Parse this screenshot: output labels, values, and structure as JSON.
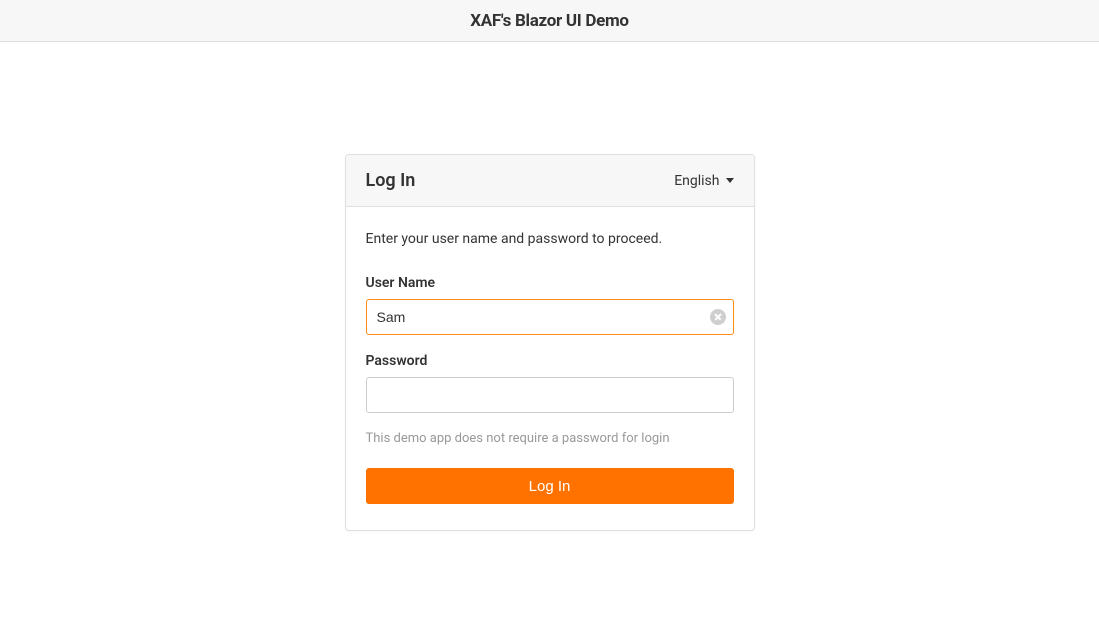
{
  "header": {
    "title": "XAF's Blazor UI Demo"
  },
  "login": {
    "title": "Log In",
    "language": "English",
    "instruction": "Enter your user name and password to proceed.",
    "username_label": "User Name",
    "username_value": "Sam",
    "password_label": "Password",
    "password_value": "",
    "hint": "This demo app does not require a password for login",
    "button_label": "Log In"
  }
}
